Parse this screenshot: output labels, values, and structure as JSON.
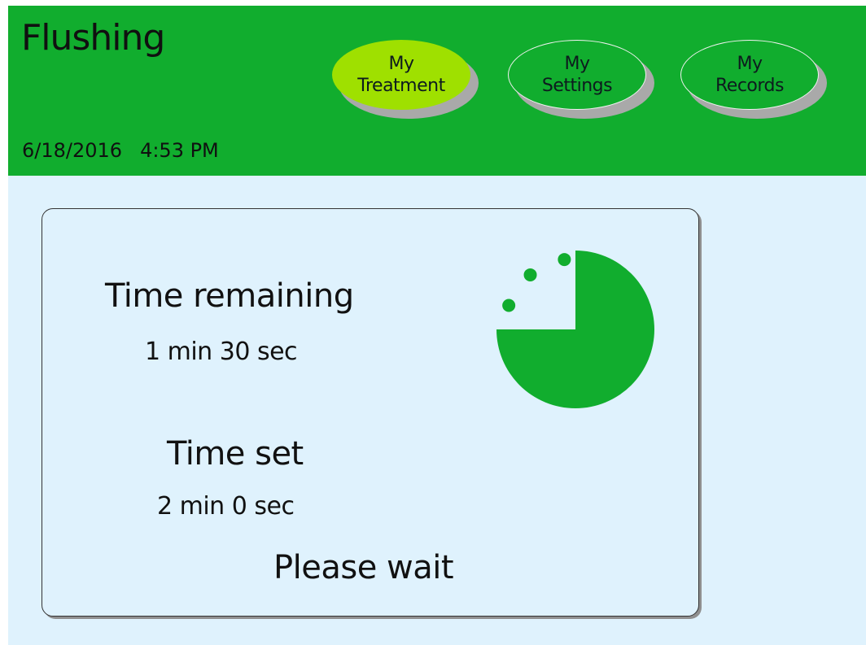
{
  "header": {
    "title": "Flushing",
    "date": "6/18/2016",
    "time": "4:53 PM",
    "background_color": "#11ad2e"
  },
  "nav": {
    "buttons": [
      {
        "label": "My\nTreatment",
        "active": true
      },
      {
        "label": "My\nSettings",
        "active": false
      },
      {
        "label": "My\nRecords",
        "active": false
      }
    ],
    "active_color": "#9fe000"
  },
  "timer": {
    "remaining_label": "Time remaining",
    "remaining_value": "1 min 30 sec",
    "set_label": "Time set",
    "set_value": "2 min 0 sec",
    "status": "Please wait",
    "remaining_seconds": 90,
    "set_seconds": 120,
    "progress_color": "#11ad2e",
    "icon": "countdown-pie-icon"
  }
}
